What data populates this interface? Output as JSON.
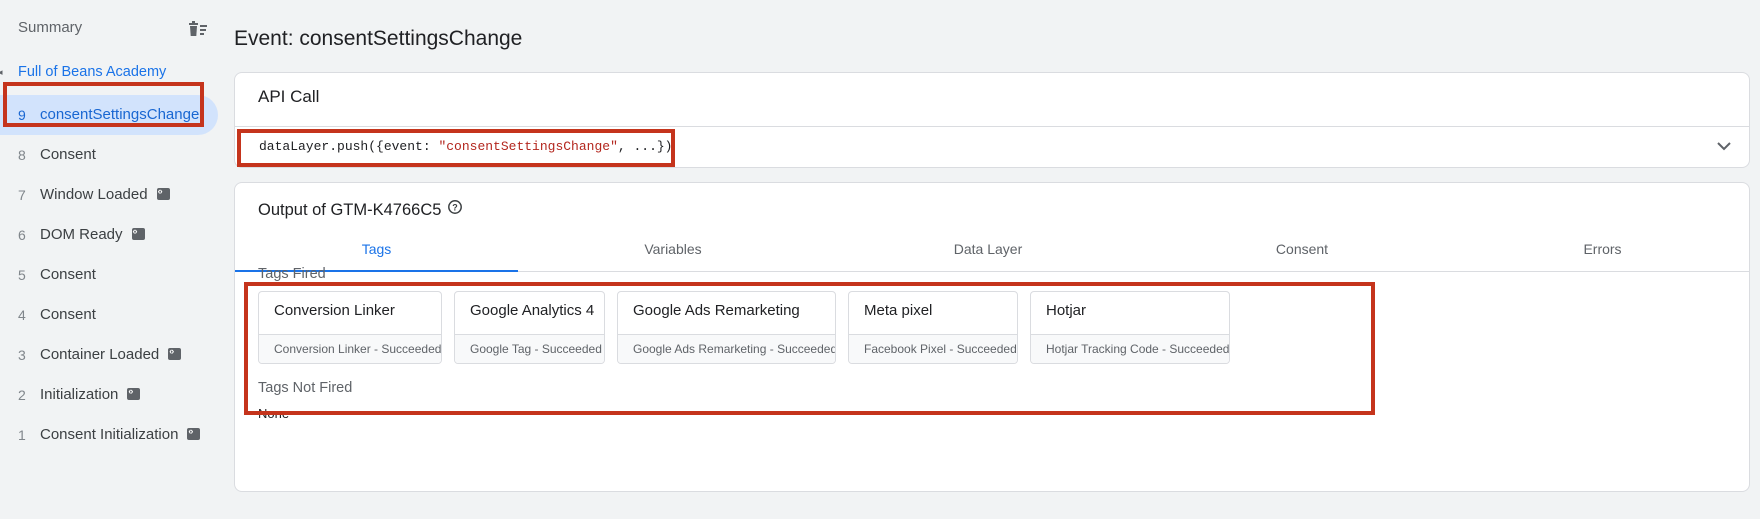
{
  "sidebar": {
    "summary_label": "Summary",
    "container_name": "Full of Beans Academy",
    "events": [
      {
        "num": "9",
        "label": "consentSettingsChange",
        "badge": false,
        "active": true
      },
      {
        "num": "8",
        "label": "Consent",
        "badge": false,
        "active": false
      },
      {
        "num": "7",
        "label": "Window Loaded",
        "badge": true,
        "active": false
      },
      {
        "num": "6",
        "label": "DOM Ready",
        "badge": true,
        "active": false
      },
      {
        "num": "5",
        "label": "Consent",
        "badge": false,
        "active": false
      },
      {
        "num": "4",
        "label": "Consent",
        "badge": false,
        "active": false
      },
      {
        "num": "3",
        "label": "Container Loaded",
        "badge": true,
        "active": false
      },
      {
        "num": "2",
        "label": "Initialization",
        "badge": true,
        "active": false
      },
      {
        "num": "1",
        "label": "Consent Initialization",
        "badge": true,
        "active": false
      }
    ]
  },
  "main": {
    "page_title": "Event: consentSettingsChange",
    "api_call": {
      "header": "API Call",
      "code_prefix": "dataLayer.push({event: ",
      "code_string": "\"consentSettingsChange\"",
      "code_suffix": ", ...})"
    },
    "output": {
      "title": "Output of GTM-K4766C5",
      "tabs": [
        {
          "label": "Tags",
          "active": true
        },
        {
          "label": "Variables",
          "active": false
        },
        {
          "label": "Data Layer",
          "active": false
        },
        {
          "label": "Consent",
          "active": false
        },
        {
          "label": "Errors",
          "active": false
        }
      ],
      "tags_fired_label": "Tags Fired",
      "tags_fired": [
        {
          "name": "Conversion Linker",
          "status": "Conversion Linker - Succeeded"
        },
        {
          "name": "Google Analytics 4",
          "status": "Google Tag - Succeeded"
        },
        {
          "name": "Google Ads Remarketing",
          "status": "Google Ads Remarketing - Succeeded"
        },
        {
          "name": "Meta pixel",
          "status": "Facebook Pixel - Succeeded"
        },
        {
          "name": "Hotjar",
          "status": "Hotjar Tracking Code - Succeeded"
        }
      ],
      "tags_not_fired_label": "Tags Not Fired",
      "tags_not_fired_value": "None"
    }
  },
  "colors": {
    "accent": "#1a73e8",
    "active_bg": "#d2e3fc",
    "highlight_box": "#c5341c"
  },
  "icons": {
    "trash": "delete-sweep-icon",
    "container_caret": "caret-icon",
    "script_badge": "code-badge-icon",
    "expand": "chevron-down-icon",
    "help": "help-circle-icon"
  }
}
